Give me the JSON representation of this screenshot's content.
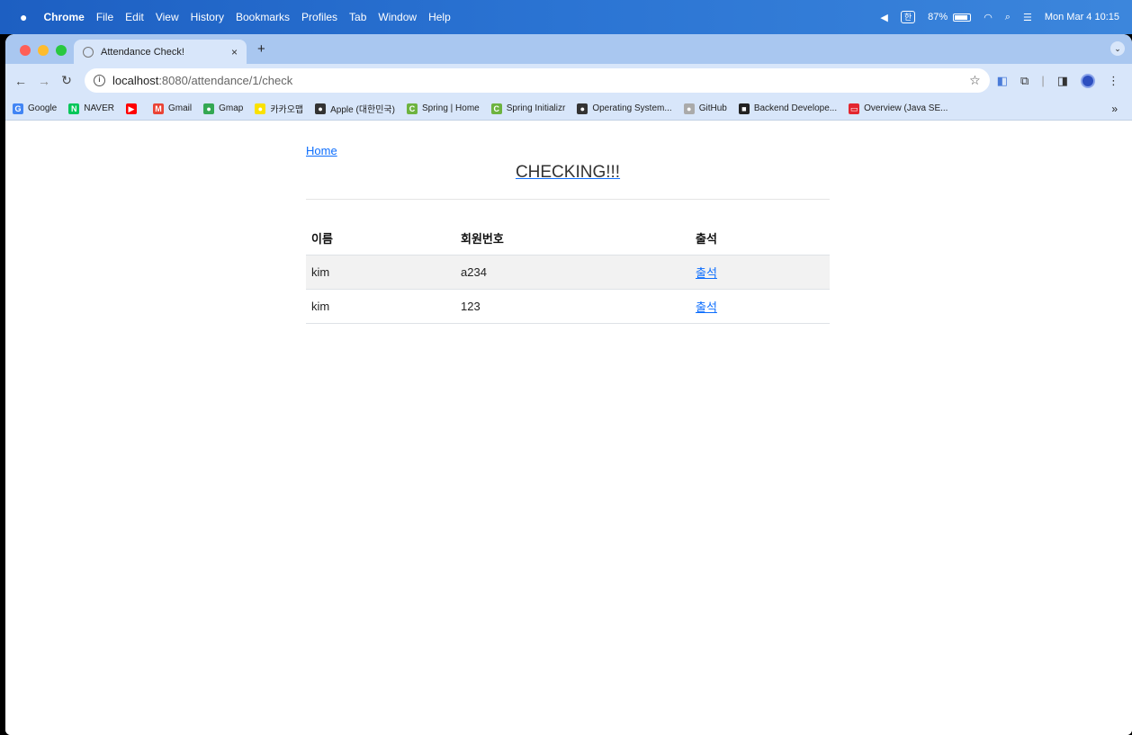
{
  "menubar": {
    "app": "Chrome",
    "items": [
      "File",
      "Edit",
      "View",
      "History",
      "Bookmarks",
      "Profiles",
      "Tab",
      "Window",
      "Help"
    ],
    "input_source": "한",
    "battery_percent": "87%",
    "battery_level": 0.87,
    "clock": "Mon Mar 4  10:15"
  },
  "browser": {
    "tab_title": "Attendance Check!",
    "tab_close": "×",
    "new_tab": "+",
    "url_host": "localhost",
    "url_path": ":8080/attendance/1/check",
    "bookmarks": [
      {
        "label": "Google",
        "icon": "google-icon",
        "color": "#4285f4",
        "glyph": "G"
      },
      {
        "label": "NAVER",
        "icon": "naver-icon",
        "color": "#03c75a",
        "glyph": "N"
      },
      {
        "label": "",
        "icon": "youtube-icon",
        "color": "#ff0000",
        "glyph": "▶"
      },
      {
        "label": "Gmail",
        "icon": "gmail-icon",
        "color": "#ea4335",
        "glyph": "M"
      },
      {
        "label": "Gmap",
        "icon": "gmap-icon",
        "color": "#34a853",
        "glyph": "●"
      },
      {
        "label": "카카오맵",
        "icon": "kakaomap-icon",
        "color": "#fae100",
        "glyph": "●"
      },
      {
        "label": "Apple (대한민국)",
        "icon": "apple-icon",
        "color": "#333333",
        "glyph": "●"
      },
      {
        "label": "Spring | Home",
        "icon": "spring-icon",
        "color": "#6db33f",
        "glyph": "C"
      },
      {
        "label": "Spring Initializr",
        "icon": "spring-icon",
        "color": "#6db33f",
        "glyph": "C"
      },
      {
        "label": "Operating System...",
        "icon": "globe-icon",
        "color": "#333333",
        "glyph": "●"
      },
      {
        "label": "GitHub",
        "icon": "github-icon",
        "color": "#aaaaaa",
        "glyph": "●"
      },
      {
        "label": "Backend Develope...",
        "icon": "backend-icon",
        "color": "#222222",
        "glyph": "■"
      },
      {
        "label": "Overview (Java SE...",
        "icon": "oracle-icon",
        "color": "#e3262f",
        "glyph": "▭"
      }
    ],
    "bookmarks_more": "»"
  },
  "page": {
    "home_link": "Home",
    "heading": "CHECKING!!!",
    "table": {
      "headers": [
        "이름",
        "회원번호",
        "출석"
      ],
      "rows": [
        {
          "name": "kim",
          "member_no": "a234",
          "action": "출석"
        },
        {
          "name": "kim",
          "member_no": "123",
          "action": "출석"
        }
      ]
    }
  },
  "colors": {
    "menubar": "#2b74d3",
    "tabstrip": "#a9c7f0",
    "toolbar": "#d8e6fa",
    "link": "#0d6efd",
    "traffic_close": "#ff5f57",
    "traffic_min": "#febc2e",
    "traffic_max": "#28c840"
  }
}
